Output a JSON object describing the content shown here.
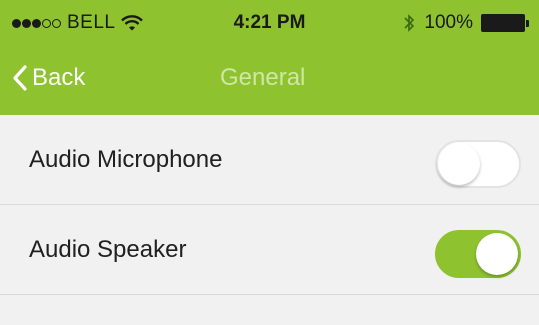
{
  "status_bar": {
    "signal_filled": 3,
    "signal_total": 5,
    "carrier": "BELL",
    "time": "4:21 PM",
    "battery_text": "100%",
    "wifi_icon": "wifi-icon",
    "bluetooth_icon": "bluetooth-icon",
    "battery_icon": "battery-icon"
  },
  "nav": {
    "back_label": "Back",
    "back_icon": "chevron-left-icon",
    "title": "General"
  },
  "settings": [
    {
      "label": "Audio Microphone",
      "enabled": false
    },
    {
      "label": "Audio Speaker",
      "enabled": true
    }
  ],
  "colors": {
    "accent": "#8ec22f",
    "title_muted": "#cfe7a4",
    "background": "#f1f1f1"
  }
}
